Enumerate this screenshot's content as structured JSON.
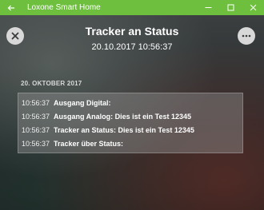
{
  "window": {
    "title": "Loxone Smart Home",
    "accent_color": "#6fbf3f",
    "back_icon": "arrow-left-icon",
    "controls": {
      "minimize_icon": "minimize-icon",
      "maximize_icon": "maximize-icon",
      "close_icon": "close-icon"
    }
  },
  "header": {
    "title": "Tracker an Status",
    "datetime": "20.10.2017 10:56:37",
    "close_icon": "close-circle-icon",
    "more_icon": "more-dots-icon"
  },
  "log": {
    "date_label": "20. OKTOBER 2017",
    "entries": [
      {
        "time": "10:56:37",
        "message": "Ausgang Digital:"
      },
      {
        "time": "10:56:37",
        "message": "Ausgang Analog: Dies ist ein Test 12345"
      },
      {
        "time": "10:56:37",
        "message": "Tracker an Status: Dies ist ein Test 12345"
      },
      {
        "time": "10:56:37",
        "message": "Tracker über Status:"
      }
    ]
  }
}
